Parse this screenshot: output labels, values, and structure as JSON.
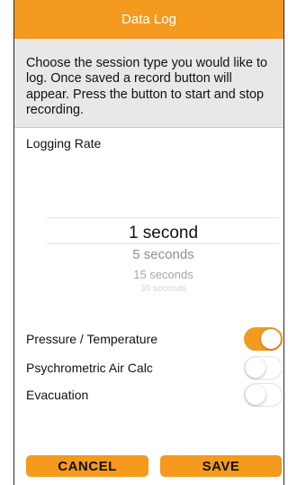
{
  "header": {
    "title": "Data Log"
  },
  "instructions": "Choose the session type you would like to log. Once saved a record button will appear. Press the button to start and stop recording.",
  "logging_rate": {
    "label": "Logging Rate",
    "options": [
      "1 second",
      "5 seconds",
      "15 seconds",
      "30 seconds"
    ],
    "selected": "1 second"
  },
  "toggles": [
    {
      "label": "Pressure / Temperature",
      "on": true
    },
    {
      "label": "Psychrometric Air Calc",
      "on": false
    },
    {
      "label": "Evacuation",
      "on": false
    }
  ],
  "actions": {
    "cancel_label": "CANCEL",
    "save_label": "SAVE"
  },
  "colors": {
    "accent": "#f39a1f",
    "info_bg": "#e8e8e8"
  }
}
